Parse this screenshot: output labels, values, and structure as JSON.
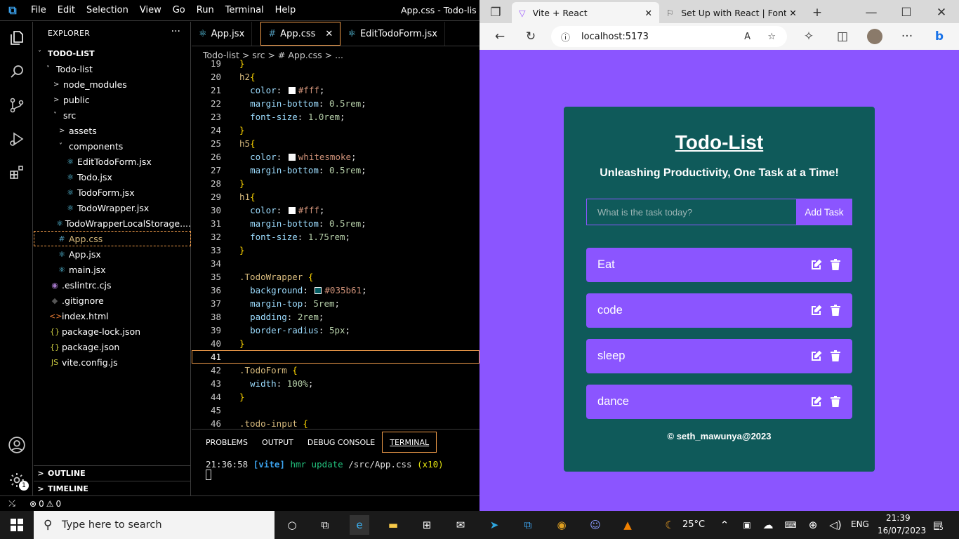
{
  "vscode": {
    "menu": [
      "File",
      "Edit",
      "Selection",
      "View",
      "Go",
      "Run",
      "Terminal",
      "Help"
    ],
    "window_title": "App.css - Todo-list -",
    "explorer_title": "EXPLORER",
    "tree": [
      {
        "label": "TODO-LIST",
        "icon": "",
        "chev": "˅"
      },
      {
        "label": "Todo-list",
        "icon": "",
        "chev": "˅"
      },
      {
        "label": "node_modules",
        "icon": "",
        "chev": ">"
      },
      {
        "label": "public",
        "icon": "",
        "chev": ">"
      },
      {
        "label": "src",
        "icon": "",
        "chev": "˅"
      },
      {
        "label": "assets",
        "icon": "",
        "chev": ">"
      },
      {
        "label": "components",
        "icon": "",
        "chev": "˅"
      },
      {
        "label": "EditTodoForm.jsx",
        "icon": "⚛",
        "chev": ""
      },
      {
        "label": "Todo.jsx",
        "icon": "⚛",
        "chev": ""
      },
      {
        "label": "TodoForm.jsx",
        "icon": "⚛",
        "chev": ""
      },
      {
        "label": "TodoWrapper.jsx",
        "icon": "⚛",
        "chev": ""
      },
      {
        "label": "TodoWrapperLocalStorage....",
        "icon": "⚛",
        "chev": ""
      },
      {
        "label": "App.css",
        "icon": "#",
        "chev": ""
      },
      {
        "label": "App.jsx",
        "icon": "⚛",
        "chev": ""
      },
      {
        "label": "main.jsx",
        "icon": "⚛",
        "chev": ""
      },
      {
        "label": ".eslintrc.cjs",
        "icon": "◉",
        "chev": ""
      },
      {
        "label": ".gitignore",
        "icon": "◆",
        "chev": ""
      },
      {
        "label": "index.html",
        "icon": "<>",
        "chev": ""
      },
      {
        "label": "package-lock.json",
        "icon": "{}",
        "chev": ""
      },
      {
        "label": "package.json",
        "icon": "{}",
        "chev": ""
      },
      {
        "label": "vite.config.js",
        "icon": "JS",
        "chev": ""
      }
    ],
    "outline": "OUTLINE",
    "timeline": "TIMELINE",
    "tabs": [
      "App.jsx",
      "App.css",
      "EditTodoForm.jsx"
    ],
    "breadcrumb": "Todo-list > src > # App.css > ...",
    "code": [
      {
        "n": "19",
        "t": "}"
      },
      {
        "n": "20",
        "t": "h2{"
      },
      {
        "n": "21",
        "t": "  color: ■#fff;"
      },
      {
        "n": "22",
        "t": "  margin-bottom: 0.5rem;"
      },
      {
        "n": "23",
        "t": "  font-size: 1.0rem;"
      },
      {
        "n": "24",
        "t": "}"
      },
      {
        "n": "25",
        "t": "h5{"
      },
      {
        "n": "26",
        "t": "  color: ■whitesmoke;"
      },
      {
        "n": "27",
        "t": "  margin-bottom: 0.5rem;"
      },
      {
        "n": "28",
        "t": "}"
      },
      {
        "n": "29",
        "t": "h1{"
      },
      {
        "n": "30",
        "t": "  color: ■#fff;"
      },
      {
        "n": "31",
        "t": "  margin-bottom: 0.5rem;"
      },
      {
        "n": "32",
        "t": "  font-size: 1.75rem;"
      },
      {
        "n": "33",
        "t": "}"
      },
      {
        "n": "34",
        "t": ""
      },
      {
        "n": "35",
        "t": ".TodoWrapper {"
      },
      {
        "n": "36",
        "t": "  background: ■#035b61;"
      },
      {
        "n": "37",
        "t": "  margin-top: 5rem;"
      },
      {
        "n": "38",
        "t": "  padding: 2rem;"
      },
      {
        "n": "39",
        "t": "  border-radius: 5px;"
      },
      {
        "n": "40",
        "t": "}"
      },
      {
        "n": "41",
        "t": ""
      },
      {
        "n": "42",
        "t": ".TodoForm {"
      },
      {
        "n": "43",
        "t": "  width: 100%;"
      },
      {
        "n": "44",
        "t": "}"
      },
      {
        "n": "45",
        "t": ""
      },
      {
        "n": "46",
        "t": ".todo-input {"
      }
    ],
    "panel_tabs": [
      "PROBLEMS",
      "OUTPUT",
      "DEBUG CONSOLE",
      "TERMINAL"
    ],
    "terminal_time": "21:36:58",
    "terminal_vite": "[vite]",
    "terminal_hmr": "hmr update",
    "terminal_path": "/src/App.css",
    "terminal_count": "(x10)",
    "status_errors": "0",
    "status_warnings": "0",
    "accounts_badge": "1"
  },
  "browser": {
    "tabs": [
      "Vite + React",
      "Set Up with React | Font Aw"
    ],
    "url": "localhost:5173",
    "app": {
      "title": "Todo-List",
      "subtitle": "Unleashing Productivity, One Task at a Time!",
      "input_placeholder": "What is the task today?",
      "add_button": "Add Task",
      "todos": [
        "Eat",
        "code",
        "sleep",
        "dance"
      ],
      "footer": "© seth_mawunya@2023"
    }
  },
  "taskbar": {
    "search_placeholder": "Type here to search",
    "weather": "25°C",
    "language": "ENG",
    "time": "21:39",
    "date": "16/07/2023",
    "notifications": "5"
  },
  "colors": {
    "app_bg": "#0f5a5a",
    "accent": "#8b55ff",
    "editor_bg": "#000000"
  }
}
